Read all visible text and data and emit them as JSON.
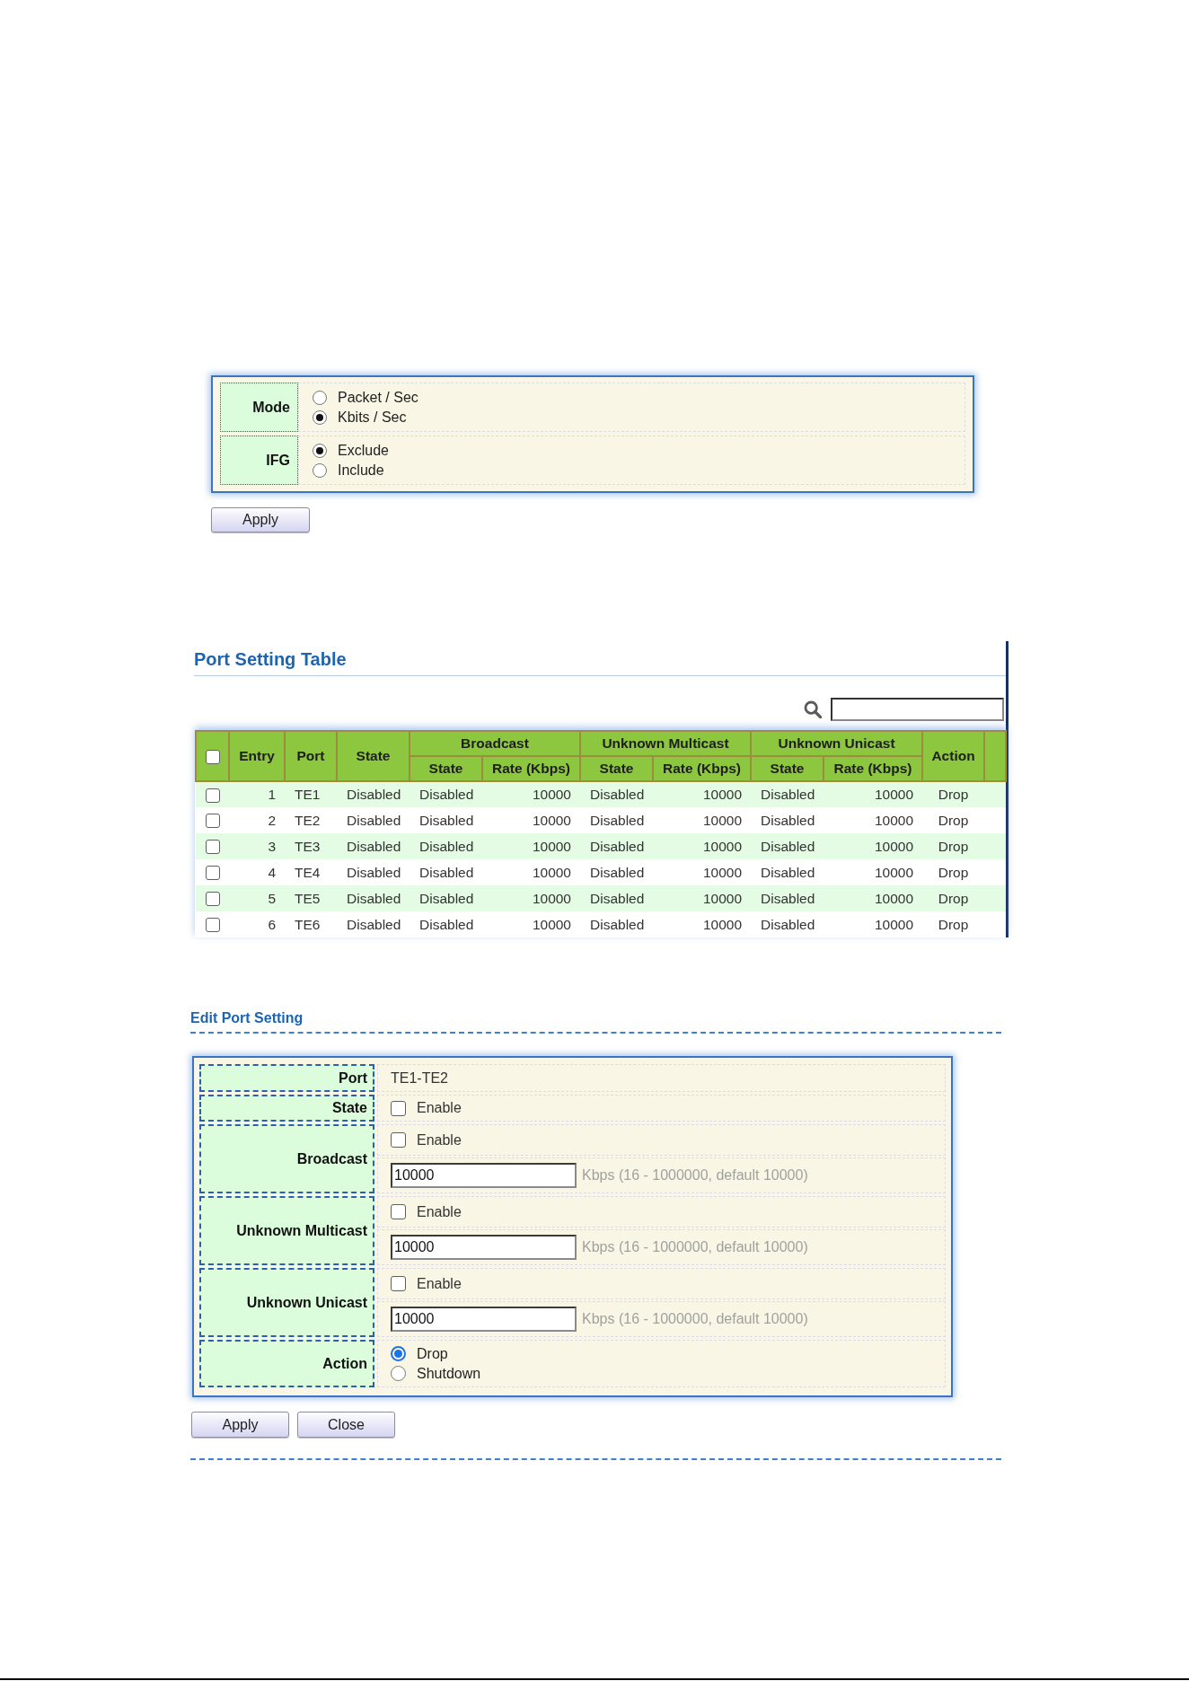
{
  "rate_limit": {
    "rows": [
      {
        "label": "Mode",
        "options": [
          {
            "label": "Packet / Sec",
            "selected": false
          },
          {
            "label": "Kbits / Sec",
            "selected": true
          }
        ]
      },
      {
        "label": "IFG",
        "options": [
          {
            "label": "Exclude",
            "selected": true
          },
          {
            "label": "Include",
            "selected": false
          }
        ]
      }
    ],
    "apply_button": "Apply"
  },
  "port_setting_table": {
    "title": "Port Setting Table",
    "select_all": {
      "checked": false
    },
    "columns": [
      {
        "label": "Entry"
      },
      {
        "label": "Port"
      },
      {
        "label": "State"
      },
      {
        "label": "Broadcast",
        "colspan": 2,
        "subcolumns": [
          "State",
          "Rate (Kbps)"
        ]
      },
      {
        "label": "Unknown Multicast",
        "colspan": 2,
        "subcolumns": [
          "State",
          "Rate (Kbps)"
        ]
      },
      {
        "label": "Unknown Unicast",
        "colspan": 2,
        "subcolumns": [
          "State",
          "Rate (Kbps)"
        ]
      },
      {
        "label": "Action"
      }
    ],
    "rows": [
      {
        "checked": false,
        "cells": [
          "1",
          "TE1",
          "Disabled",
          "Disabled",
          "10000",
          "Disabled",
          "10000",
          "Disabled",
          "10000",
          "Drop"
        ]
      },
      {
        "checked": false,
        "cells": [
          "2",
          "TE2",
          "Disabled",
          "Disabled",
          "10000",
          "Disabled",
          "10000",
          "Disabled",
          "10000",
          "Drop"
        ]
      },
      {
        "checked": false,
        "cells": [
          "3",
          "TE3",
          "Disabled",
          "Disabled",
          "10000",
          "Disabled",
          "10000",
          "Disabled",
          "10000",
          "Drop"
        ]
      },
      {
        "checked": false,
        "cells": [
          "4",
          "TE4",
          "Disabled",
          "Disabled",
          "10000",
          "Disabled",
          "10000",
          "Disabled",
          "10000",
          "Drop"
        ]
      },
      {
        "checked": false,
        "cells": [
          "5",
          "TE5",
          "Disabled",
          "Disabled",
          "10000",
          "Disabled",
          "10000",
          "Disabled",
          "10000",
          "Drop"
        ]
      },
      {
        "checked": false,
        "cells": [
          "6",
          "TE6",
          "Disabled",
          "Disabled",
          "10000",
          "Disabled",
          "10000",
          "Disabled",
          "10000",
          "Drop"
        ]
      }
    ]
  },
  "edit_port_setting": {
    "title": "Edit Port Setting",
    "fields": [
      {
        "kind": "text",
        "label": "Port",
        "value": "TE1-TE2"
      },
      {
        "kind": "checkbox",
        "label": "State",
        "option": "Enable",
        "checked": false
      },
      {
        "kind": "rate",
        "label": "Broadcast",
        "option": "Enable",
        "checked": false,
        "value": "10000",
        "hint": "Kbps (16 - 1000000, default 10000)"
      },
      {
        "kind": "rate",
        "label": "Unknown Multicast",
        "option": "Enable",
        "checked": false,
        "value": "10000",
        "hint": "Kbps (16 - 1000000, default 10000)"
      },
      {
        "kind": "rate",
        "label": "Unknown Unicast",
        "option": "Enable",
        "checked": false,
        "value": "10000",
        "hint": "Kbps (16 - 1000000, default 10000)"
      },
      {
        "kind": "radio",
        "label": "Action",
        "options": [
          {
            "label": "Drop",
            "selected": true
          },
          {
            "label": "Shutdown",
            "selected": false
          }
        ]
      }
    ],
    "buttons": [
      "Apply",
      "Close"
    ]
  }
}
